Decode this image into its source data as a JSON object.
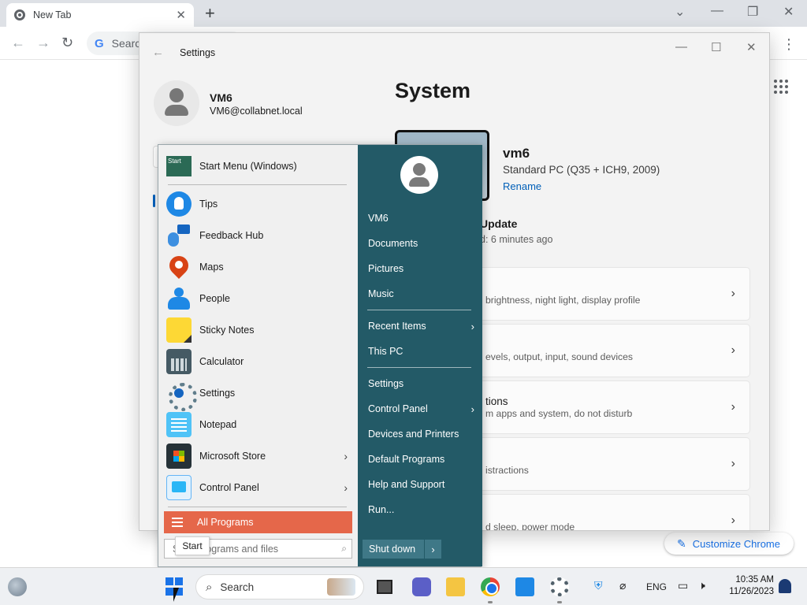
{
  "chrome": {
    "tab_title": "New Tab",
    "tab_close": "✕",
    "new_tab": "+",
    "search_placeholder": "Search",
    "customize_label": "Customize Chrome"
  },
  "settings": {
    "window_title": "Settings",
    "user_name": "VM6",
    "user_email": "VM6@collabnet.local",
    "heading": "System",
    "pc_name": "vm6",
    "pc_model": "Standard PC (Q35 + ICH9, 2009)",
    "rename_label": "Rename",
    "update_title": "Update",
    "update_sub": "d: 6 minutes ago",
    "cards": [
      {
        "title": "",
        "desc": "brightness, night light, display profile"
      },
      {
        "title": "",
        "desc": "evels, output, input, sound devices"
      },
      {
        "title": "tions",
        "desc": "m apps and system, do not disturb"
      },
      {
        "title": "",
        "desc": "istractions"
      },
      {
        "title": "",
        "desc": "d sleep, power mode"
      }
    ]
  },
  "start_menu": {
    "pinned_header": "Start Menu (Windows)",
    "pinned_icon_text": "Start",
    "items": [
      {
        "label": "Tips",
        "icon": "tips-icon"
      },
      {
        "label": "Feedback Hub",
        "icon": "feedback-hub-icon"
      },
      {
        "label": "Maps",
        "icon": "maps-icon"
      },
      {
        "label": "People",
        "icon": "people-icon"
      },
      {
        "label": "Sticky Notes",
        "icon": "sticky-notes-icon"
      },
      {
        "label": "Calculator",
        "icon": "calculator-icon"
      },
      {
        "label": "Settings",
        "icon": "settings-icon"
      },
      {
        "label": "Notepad",
        "icon": "notepad-icon"
      },
      {
        "label": "Microsoft Store",
        "icon": "store-icon",
        "submenu": true
      },
      {
        "label": "Control Panel",
        "icon": "control-panel-icon",
        "submenu": true
      }
    ],
    "all_programs": "All Programs",
    "search_text": "S",
    "search_text_tail": "ograms and files",
    "tooltip": "Start",
    "right_items": [
      {
        "label": "VM6"
      },
      {
        "label": "Documents"
      },
      {
        "label": "Pictures"
      },
      {
        "label": "Music"
      },
      {
        "label": "Recent Items",
        "submenu": true
      },
      {
        "label": "This PC"
      },
      {
        "label": "Settings"
      },
      {
        "label": "Control Panel",
        "submenu": true
      },
      {
        "label": "Devices and Printers"
      },
      {
        "label": "Default Programs"
      },
      {
        "label": "Help and Support"
      },
      {
        "label": "Run..."
      }
    ],
    "shutdown": "Shut down"
  },
  "taskbar": {
    "search_label": "Search",
    "language": "ENG",
    "time": "10:35 AM",
    "date": "11/26/2023"
  },
  "colors": {
    "start_right_panel": "#235a67",
    "all_programs_bg": "#e5674a",
    "accent": "#005fb8"
  }
}
